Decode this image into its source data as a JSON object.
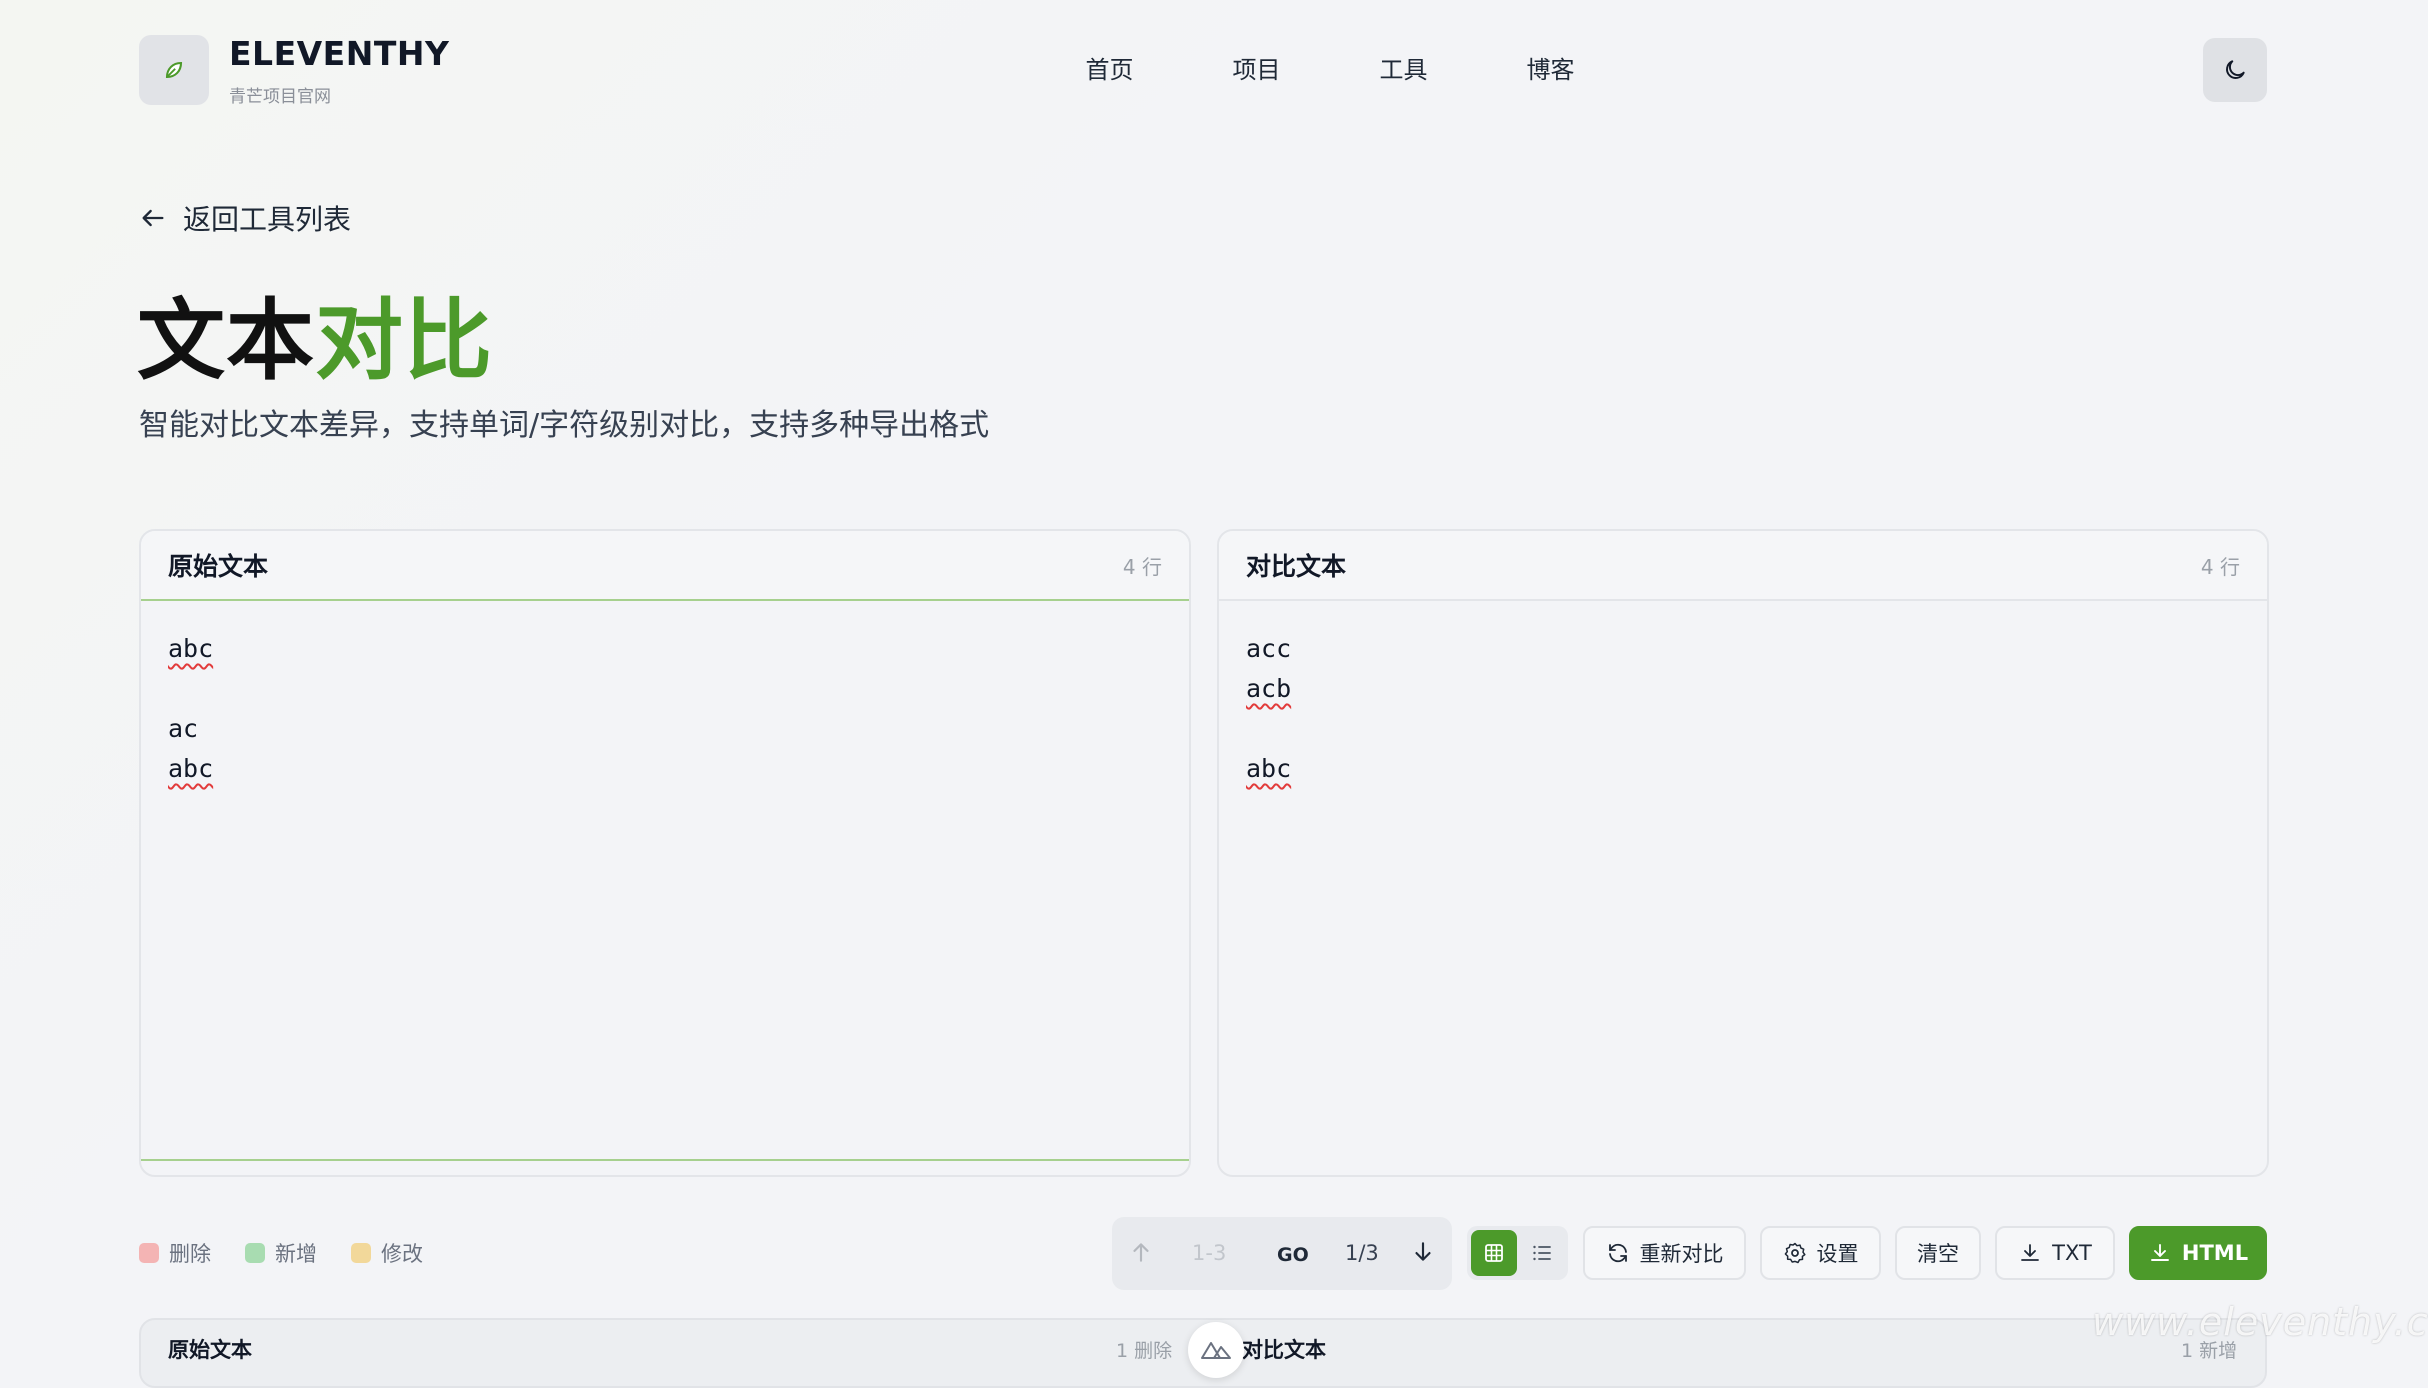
{
  "brand": {
    "name": "ELEVENTHY",
    "subtitle": "青芒项目官网"
  },
  "nav": {
    "items": [
      {
        "label": "首页"
      },
      {
        "label": "项目"
      },
      {
        "label": "工具"
      },
      {
        "label": "博客"
      }
    ]
  },
  "icons": {
    "logo": "leaf-logo-icon",
    "theme": "moon-icon",
    "back": "arrow-left-icon",
    "up": "arrow-up-icon",
    "down": "arrow-down-icon",
    "grid": "grid-icon",
    "list": "list-icon",
    "refresh": "refresh-icon",
    "settings": "gear-icon",
    "download": "download-icon"
  },
  "back": {
    "label": "返回工具列表"
  },
  "title": {
    "main": "文本",
    "accent": "对比"
  },
  "subtitle": "智能对比文本差异，支持单词/字符级别对比，支持多种导出格式",
  "editors": {
    "left": {
      "title": "原始文本",
      "count": "4 行",
      "lines": [
        "abc",
        "",
        "ac",
        "abc"
      ]
    },
    "right": {
      "title": "对比文本",
      "count": "4 行",
      "lines": [
        "acc",
        "acb",
        "",
        "abc"
      ]
    }
  },
  "legend": {
    "delete": "删除",
    "add": "新增",
    "modify": "修改"
  },
  "navigator": {
    "range": "1-3",
    "go": "GO",
    "position": "1/3"
  },
  "toolbar": {
    "recompare": "重新对比",
    "settings": "设置",
    "clear": "清空",
    "txt": "TXT",
    "html": "HTML"
  },
  "result": {
    "left_title": "原始文本",
    "left_count": "1 删除",
    "right_title": "对比文本",
    "right_count": "1 新增"
  },
  "watermark": "www.eleventhy.cn",
  "colors": {
    "accent": "#4c9a2a",
    "delete": "#f4b4b4",
    "add": "#a8dcb1",
    "modify": "#f2d89a"
  }
}
